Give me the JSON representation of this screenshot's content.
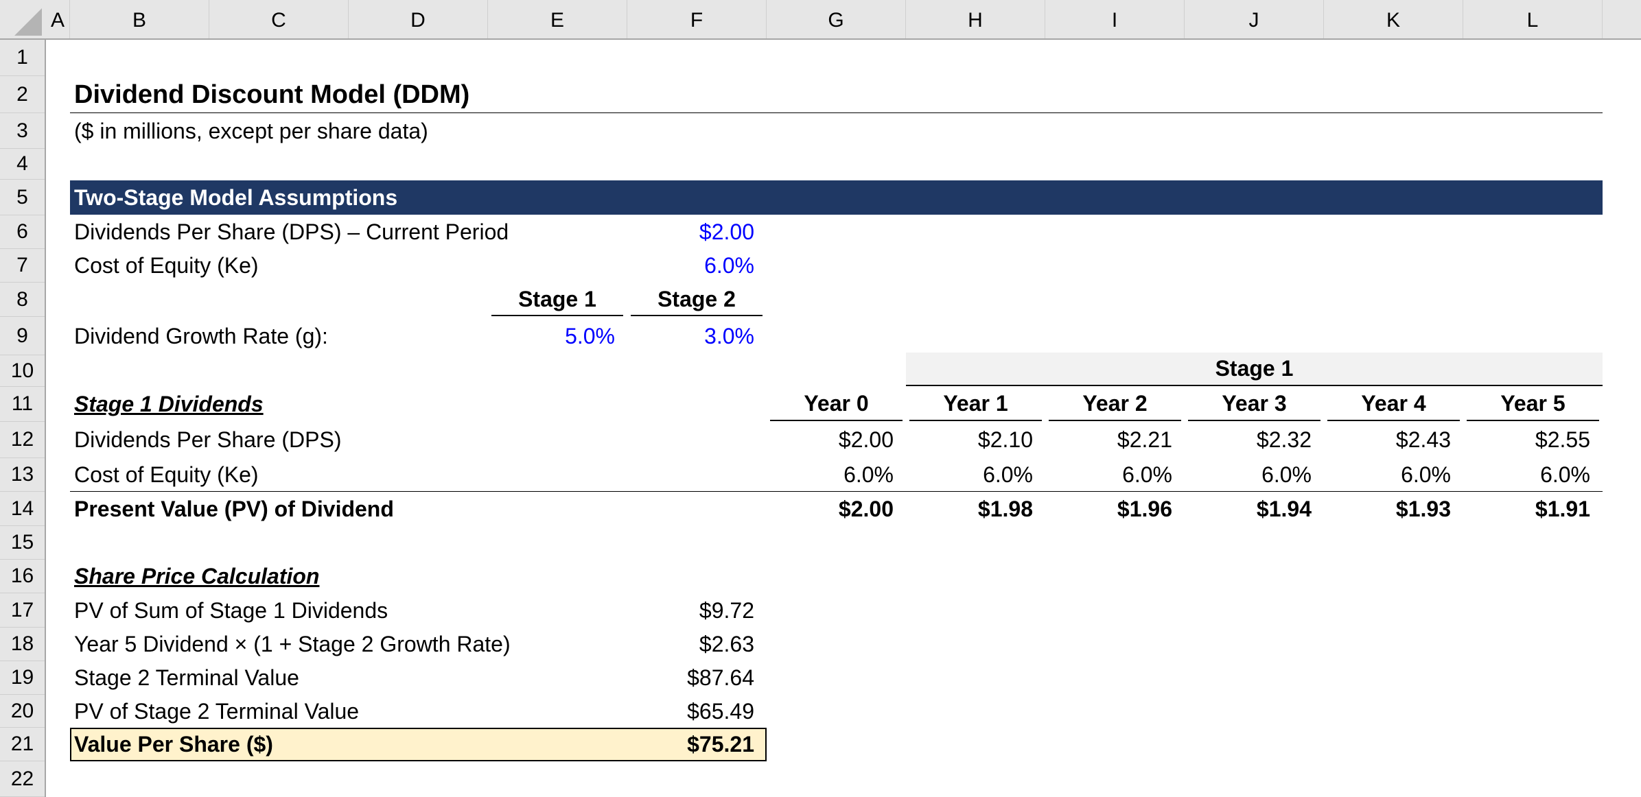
{
  "columns": [
    "A",
    "B",
    "C",
    "D",
    "E",
    "F",
    "G",
    "H",
    "I",
    "J",
    "K",
    "L"
  ],
  "rows": [
    "1",
    "2",
    "3",
    "4",
    "5",
    "6",
    "7",
    "8",
    "9",
    "10",
    "11",
    "12",
    "13",
    "14",
    "15",
    "16",
    "17",
    "18",
    "19",
    "20",
    "21",
    "22"
  ],
  "title": "Dividend Discount Model (DDM)",
  "subtitle": "($ in millions, except per share data)",
  "assumptions": {
    "header": "Two-Stage Model Assumptions",
    "dps_label": "Dividends Per Share (DPS) – Current Period",
    "dps_value": "$2.00",
    "ke_label": "Cost of Equity (Ke)",
    "ke_value": "6.0%",
    "stage1_label": "Stage 1",
    "stage2_label": "Stage 2",
    "growth_label": "Dividend Growth Rate (g):",
    "growth_stage1": "5.0%",
    "growth_stage2": "3.0%"
  },
  "stage1": {
    "section_title": "Stage 1 Dividends",
    "band_label": "Stage 1",
    "years": [
      "Year 0",
      "Year 1",
      "Year 2",
      "Year 3",
      "Year 4",
      "Year 5"
    ],
    "dps_label": "Dividends Per Share (DPS)",
    "dps": [
      "$2.00",
      "$2.10",
      "$2.21",
      "$2.32",
      "$2.43",
      "$2.55"
    ],
    "ke_label": "Cost of Equity (Ke)",
    "ke": [
      "6.0%",
      "6.0%",
      "6.0%",
      "6.0%",
      "6.0%",
      "6.0%"
    ],
    "pv_label": "Present Value (PV) of Dividend",
    "pv": [
      "$2.00",
      "$1.98",
      "$1.96",
      "$1.94",
      "$1.93",
      "$1.91"
    ]
  },
  "share_price": {
    "section_title": "Share Price Calculation",
    "items": [
      {
        "label": "PV of Sum of Stage 1 Dividends",
        "value": "$9.72"
      },
      {
        "label": "Year 5 Dividend × (1 + Stage 2 Growth Rate)",
        "value": "$2.63"
      },
      {
        "label": "Stage 2 Terminal Value",
        "value": "$87.64"
      },
      {
        "label": "PV of Stage 2 Terminal Value",
        "value": "$65.49"
      }
    ],
    "result_label": "Value Per Share ($)",
    "result_value": "$75.21"
  },
  "colors": {
    "banner": "#1f3864",
    "input_blue": "#0000ff",
    "highlight": "#fff2cc",
    "stage_band": "#f2f2f2"
  }
}
